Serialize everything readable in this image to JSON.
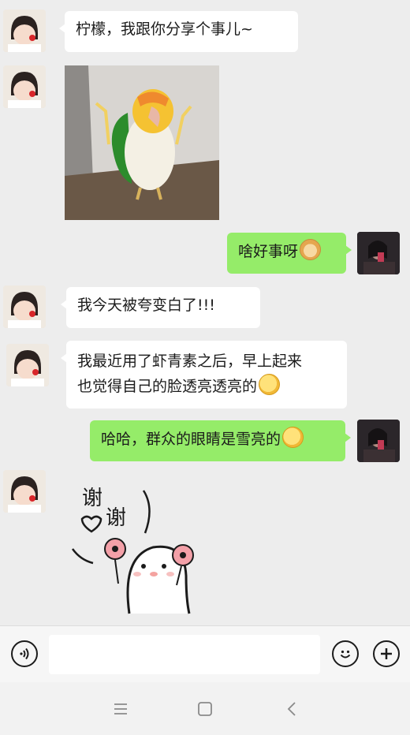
{
  "messages": {
    "m1": {
      "sender": "left",
      "text": "柠檬，我跟你分享个事儿~"
    },
    "m3": {
      "sender": "right",
      "text": "啥好事呀",
      "emoji_icon": "doge-emoji"
    },
    "m4": {
      "sender": "left",
      "text": "我今天被夸变白了!!!"
    },
    "m5": {
      "sender": "left",
      "line1": "我最近用了虾青素之后，早上起来",
      "line2": "也觉得自己的脸透亮透亮的",
      "emoji_icon": "ok-hand-emoji"
    },
    "m6": {
      "sender": "right",
      "text": "哈哈，群众的眼睛是雪亮的",
      "emoji_icon": "ok-hand-emoji"
    },
    "m7": {
      "sender": "left",
      "sticker_text": "谢谢"
    }
  },
  "colors": {
    "chat_bg": "#ededed",
    "bubble_left": "#ffffff",
    "bubble_right": "#95ec69",
    "text": "#1b1b1b"
  },
  "input_bar": {
    "voice_icon": "voice-icon",
    "emoji_icon": "smiley-icon",
    "plus_icon": "plus-icon"
  },
  "nav_bar": {
    "icons": [
      "menu-icon",
      "home-square-icon",
      "back-chevron-icon"
    ]
  }
}
